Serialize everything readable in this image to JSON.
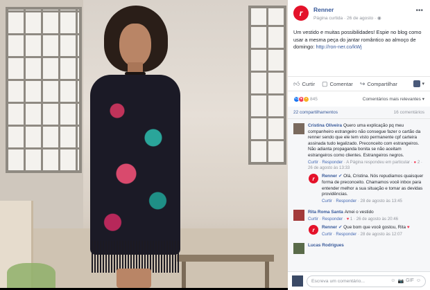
{
  "post": {
    "page_name": "Renner",
    "page_sub": "Página curtida · 26 de agosto ·",
    "logo_letter": "r",
    "text_main": "Um vestido e muitas possibilidades! Espie no blog como usar a mesma peça do jantar romântico ao almoço de domingo: ",
    "text_link": "http://ron-ner.co/kWj",
    "more_icon": "more-dots-icon"
  },
  "actions": {
    "like": "Curtir",
    "comment": "Comentar",
    "share": "Compartilhar",
    "share_menu_caret": "▾"
  },
  "stats": {
    "reaction_count": "845",
    "most_relevant": "Comentários mais relevantes ▾",
    "shares": "22 compartilhamentos",
    "comments_count": "16 comentários"
  },
  "comments": [
    {
      "name": "Cristina Oliveira",
      "text": "Quero uma explicação pq meu companheiro estrangeiro não consegue fazer o cartão da renner sendo que ele tem visto permanente cpf carteira assinada tudo legalizado. Preconceito com estrangeiros. Não adianta propaganda bonita se não aceitam estrangeiros como clientes. Estrangeiros negros.",
      "meta_like": "Curtir",
      "meta_reply": "Responder",
      "meta_text": " · A Página respondeu em particular · ",
      "meta_reacts": "2",
      "meta_date": " · 26 de agosto às 13:33"
    },
    {
      "name": "Renner",
      "text": "Olá, Cristina. Nós repudiamos quaisquer forma de preconceito. Chamamos você inbox para entender melhor a sua situação e tomar as devidas providências.",
      "meta_like": "Curtir",
      "meta_reply": "Responder",
      "meta_date": " · 28 de agosto às 13:45"
    },
    {
      "name": "Rita Roma Santa",
      "text": "Amei o vestido",
      "meta_like": "Curtir",
      "meta_reply": "Responder",
      "meta_reacts": "1",
      "meta_date": " · 26 de agosto às 20:46"
    },
    {
      "name": "Renner",
      "text": "Que bom que você gostou, Rita",
      "meta_like": "Curtir",
      "meta_reply": "Responder",
      "meta_date": " · 28 de agosto às 12:07"
    },
    {
      "name": "Lucas Rodrigues",
      "text": ""
    }
  ],
  "compose": {
    "placeholder": "Escreva um comentário...",
    "tools": [
      "☺",
      "📷",
      "GIF",
      "☺"
    ]
  }
}
